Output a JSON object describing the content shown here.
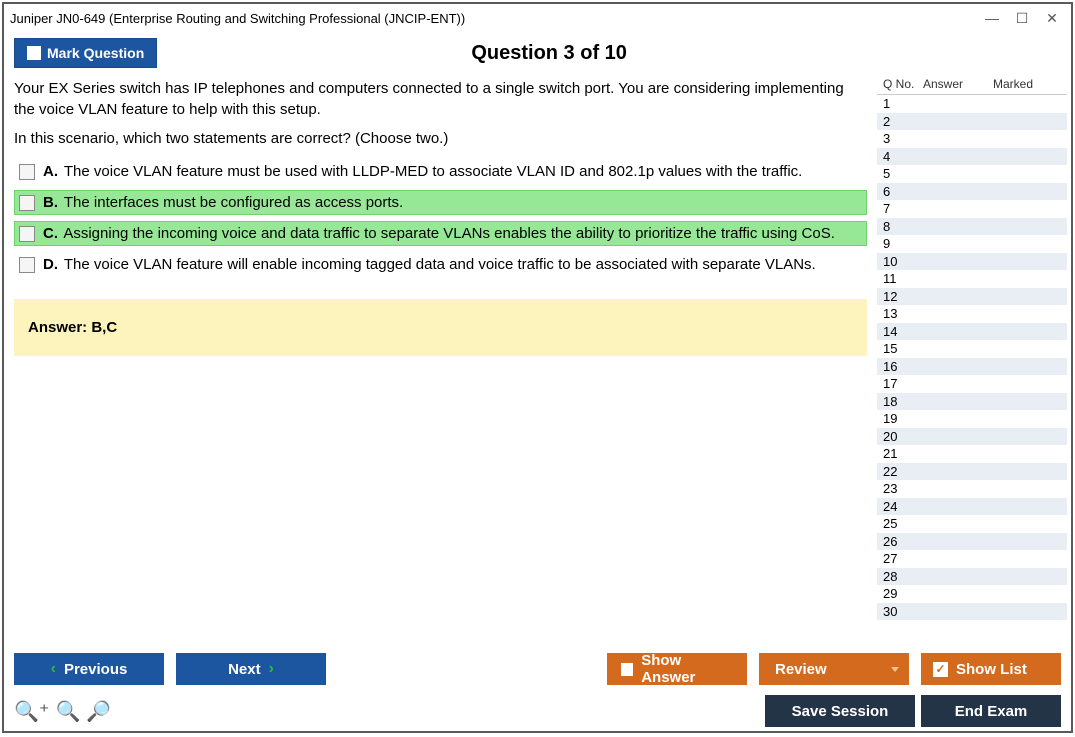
{
  "window": {
    "title": "Juniper JN0-649 (Enterprise Routing and Switching Professional (JNCIP-ENT))"
  },
  "header": {
    "mark_label": "Mark Question",
    "question_title": "Question 3 of 10"
  },
  "question": {
    "text": "Your EX Series switch has IP telephones and computers connected to a single switch port. You are considering implementing the voice VLAN feature to help with this setup.",
    "instruction": "In this scenario, which two statements are correct? (Choose two.)",
    "options": [
      {
        "letter": "A.",
        "text": "The voice VLAN feature must be used with LLDP-MED to associate VLAN ID and 802.1p values with the traffic.",
        "correct": false
      },
      {
        "letter": "B.",
        "text": "The interfaces must be configured as access ports.",
        "correct": true
      },
      {
        "letter": "C.",
        "text": "Assigning the incoming voice and data traffic to separate VLANs enables the ability to prioritize the traffic using CoS.",
        "correct": true
      },
      {
        "letter": "D.",
        "text": "The voice VLAN feature will enable incoming tagged data and voice traffic to be associated with separate VLANs.",
        "correct": false
      }
    ],
    "answer_label": "Answer: B,C"
  },
  "sidebar": {
    "col_qno": "Q No.",
    "col_answer": "Answer",
    "col_marked": "Marked",
    "rows": [
      "1",
      "2",
      "3",
      "4",
      "5",
      "6",
      "7",
      "8",
      "9",
      "10",
      "11",
      "12",
      "13",
      "14",
      "15",
      "16",
      "17",
      "18",
      "19",
      "20",
      "21",
      "22",
      "23",
      "24",
      "25",
      "26",
      "27",
      "28",
      "29",
      "30"
    ]
  },
  "buttons": {
    "previous": "Previous",
    "next": "Next",
    "show_answer": "Show Answer",
    "review": "Review",
    "show_list": "Show List",
    "save_session": "Save Session",
    "end_exam": "End Exam"
  }
}
